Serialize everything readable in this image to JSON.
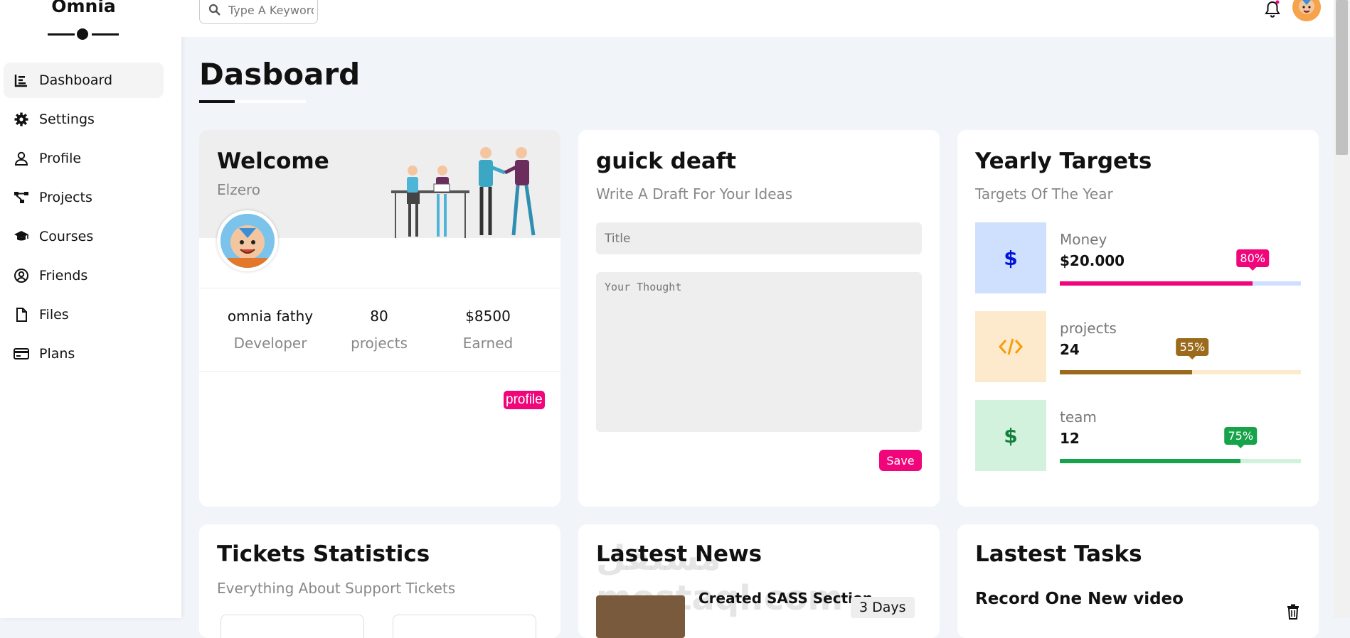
{
  "brand": {
    "name": "Omnia"
  },
  "sidebar": {
    "items": [
      {
        "label": "Dashboard",
        "icon": "chart-bar-icon",
        "active": true
      },
      {
        "label": "Settings",
        "icon": "gear-icon",
        "active": false
      },
      {
        "label": "Profile",
        "icon": "user-icon",
        "active": false
      },
      {
        "label": "Projects",
        "icon": "diagram-icon",
        "active": false
      },
      {
        "label": "Courses",
        "icon": "graduation-cap-icon",
        "active": false
      },
      {
        "label": "Friends",
        "icon": "user-circle-icon",
        "active": false
      },
      {
        "label": "Files",
        "icon": "file-icon",
        "active": false
      },
      {
        "label": "Plans",
        "icon": "credit-card-icon",
        "active": false
      }
    ]
  },
  "topbar": {
    "search_placeholder": "Type A Keyword"
  },
  "page": {
    "title": "Dasboard"
  },
  "welcome": {
    "title": "Welcome",
    "name": "Elzero",
    "stats": [
      {
        "value": "omnia fathy",
        "label": "Developer"
      },
      {
        "value": "80",
        "label": "projects"
      },
      {
        "value": "$8500",
        "label": "Earned"
      }
    ],
    "button": "profile"
  },
  "draft": {
    "title": "guick deaft",
    "subtitle": "Write A Draft For Your Ideas",
    "title_placeholder": "Title",
    "text_placeholder": "Your Thought",
    "save": "Save"
  },
  "targets": {
    "title": "Yearly Targets",
    "subtitle": "Targets Of The Year",
    "items": [
      {
        "label": "Money",
        "value": "$20.000",
        "percent": 80,
        "percent_label": "80%",
        "icon": "dollar-icon",
        "color": "#f0067a",
        "icon_color": "#0014d9",
        "bg": "#cfe0ff",
        "track": "#cfe0ff"
      },
      {
        "label": "projects",
        "value": "24",
        "percent": 55,
        "percent_label": "55%",
        "icon": "code-icon",
        "color": "#9b6a1d",
        "icon_color": "#f59e0b",
        "bg": "#fde9cc",
        "track": "#fde9cc"
      },
      {
        "label": "team",
        "value": "12",
        "percent": 75,
        "percent_label": "75%",
        "icon": "dollar-icon",
        "color": "#16a34a",
        "icon_color": "#15803d",
        "bg": "#d3f2de",
        "track": "#d3f2de"
      }
    ]
  },
  "tickets": {
    "title": "Tickets Statistics",
    "subtitle": "Everything About Support Tickets"
  },
  "news": {
    "title": "Lastest News",
    "item_title": "Created SASS Section",
    "item_days": "3 Days",
    "watermark": "مستقل mostaql.com"
  },
  "tasks": {
    "title": "Lastest Tasks",
    "item_title": "Record One New video"
  }
}
